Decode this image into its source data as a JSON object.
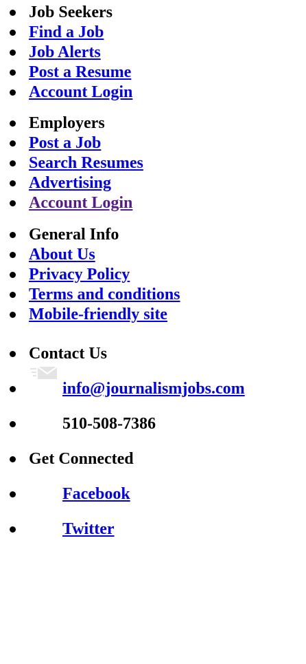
{
  "job_seekers": {
    "heading": "Job Seekers",
    "links": [
      "Find a Job",
      "Job Alerts",
      "Post a Resume",
      "Account Login"
    ]
  },
  "employers": {
    "heading": "Employers",
    "links": [
      "Post a Job",
      "Search Resumes",
      "Advertising",
      "Account Login"
    ]
  },
  "general_info": {
    "heading": "General Info",
    "links": [
      "About Us",
      "Privacy Policy",
      "Terms and conditions",
      "Mobile-friendly site"
    ]
  },
  "contact": {
    "heading": "Contact Us",
    "email": "info@journalismjobs.com",
    "email_icon": "envelope-icon",
    "phone": "510-508-7386"
  },
  "connect": {
    "heading": "Get Connected",
    "facebook": "Facebook",
    "twitter": "Twitter"
  },
  "colors": {
    "link": "#0000ee",
    "visited_link": "#551a8b",
    "text": "#000000",
    "background": "#ffffff"
  }
}
